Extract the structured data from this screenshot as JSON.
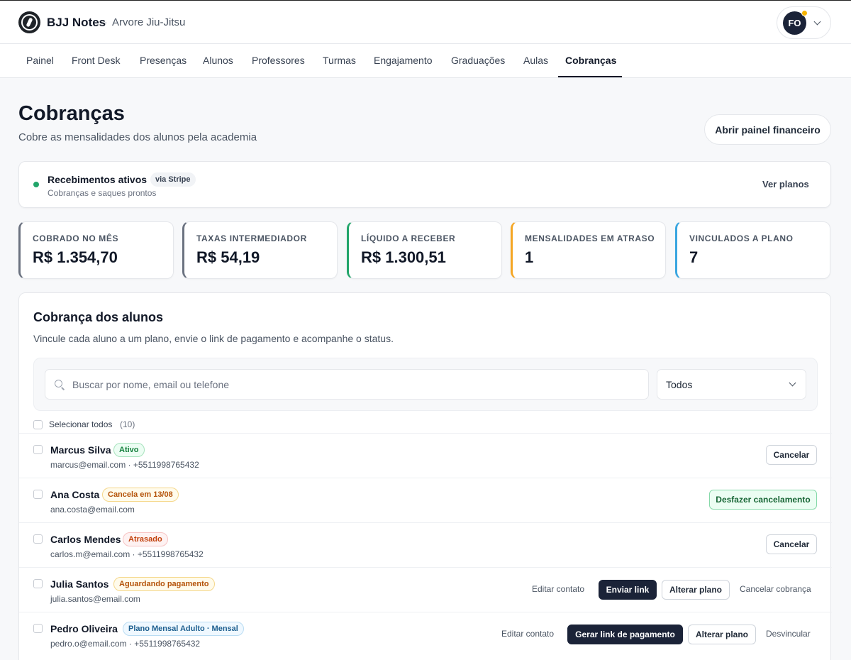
{
  "header": {
    "brand": "BJJ Notes",
    "separator": "·",
    "academy": "Arvore Jiu-Jitsu",
    "user_initials": "FO"
  },
  "nav": {
    "items": [
      "Painel",
      "Front Desk",
      "Presenças",
      "Alunos",
      "Professores",
      "Turmas",
      "Engajamento",
      "Graduações",
      "Aulas",
      "Cobranças"
    ],
    "active": "Cobranças"
  },
  "page": {
    "title": "Cobranças",
    "subtitle": "Cobre as mensalidades dos alunos pela academia",
    "finance_button": "Abrir painel financeiro"
  },
  "stripe": {
    "title": "Recebimentos ativos",
    "badge": "via Stripe",
    "subtitle": "Cobranças e saques prontos",
    "link": "Ver planos",
    "status_color": "#22a56a"
  },
  "stats": [
    {
      "label": "COBRADO NO MÊS",
      "value": "R$ 1.354,70",
      "color": "#6b7280"
    },
    {
      "label": "TAXAS INTERMEDIADOR",
      "value": "R$ 54,19",
      "color": "#6b7280"
    },
    {
      "label": "LÍQUIDO A RECEBER",
      "value": "R$ 1.300,51",
      "color": "#22a56a"
    },
    {
      "label": "MENSALIDADES EM ATRASO",
      "value": "1",
      "color": "#f5a623"
    },
    {
      "label": "VINCULADOS A PLANO",
      "value": "7",
      "color": "#3aa6e0"
    }
  ],
  "billing": {
    "title": "Cobrança dos alunos",
    "subtitle": "Vincule cada aluno a um plano, envie o link de pagamento e acompanhe o status.",
    "search_placeholder": "Buscar por nome, email ou telefone",
    "filter_value": "Todos",
    "select_all_label": "Selecionar todos",
    "select_all_count": "(10)",
    "rows": [
      {
        "name": "Marcus Silva",
        "badge": "Ativo",
        "contact": "marcus@email.com · +5511998765432",
        "actions": [
          "Cancelar"
        ]
      },
      {
        "name": "Ana Costa",
        "badge": "Cancela em 13/08",
        "contact": "ana.costa@email.com",
        "actions": [
          "Desfazer cancelamento"
        ]
      },
      {
        "name": "Carlos Mendes",
        "badge": "Atrasado",
        "contact": "carlos.m@email.com · +5511998765432",
        "actions": [
          "Cancelar"
        ]
      },
      {
        "name": "Julia Santos",
        "badge": "Aguardando pagamento",
        "contact": "julia.santos@email.com",
        "actions": [
          "Editar contato",
          "Enviar link",
          "Alterar plano",
          "Cancelar cobrança"
        ]
      },
      {
        "name": "Pedro Oliveira",
        "badge": "Plano Mensal Adulto · Mensal",
        "contact": "pedro.o@email.com · +5511998765432",
        "actions": [
          "Editar contato",
          "Gerar link de pagamento",
          "Alterar plano",
          "Desvincular"
        ]
      }
    ]
  }
}
